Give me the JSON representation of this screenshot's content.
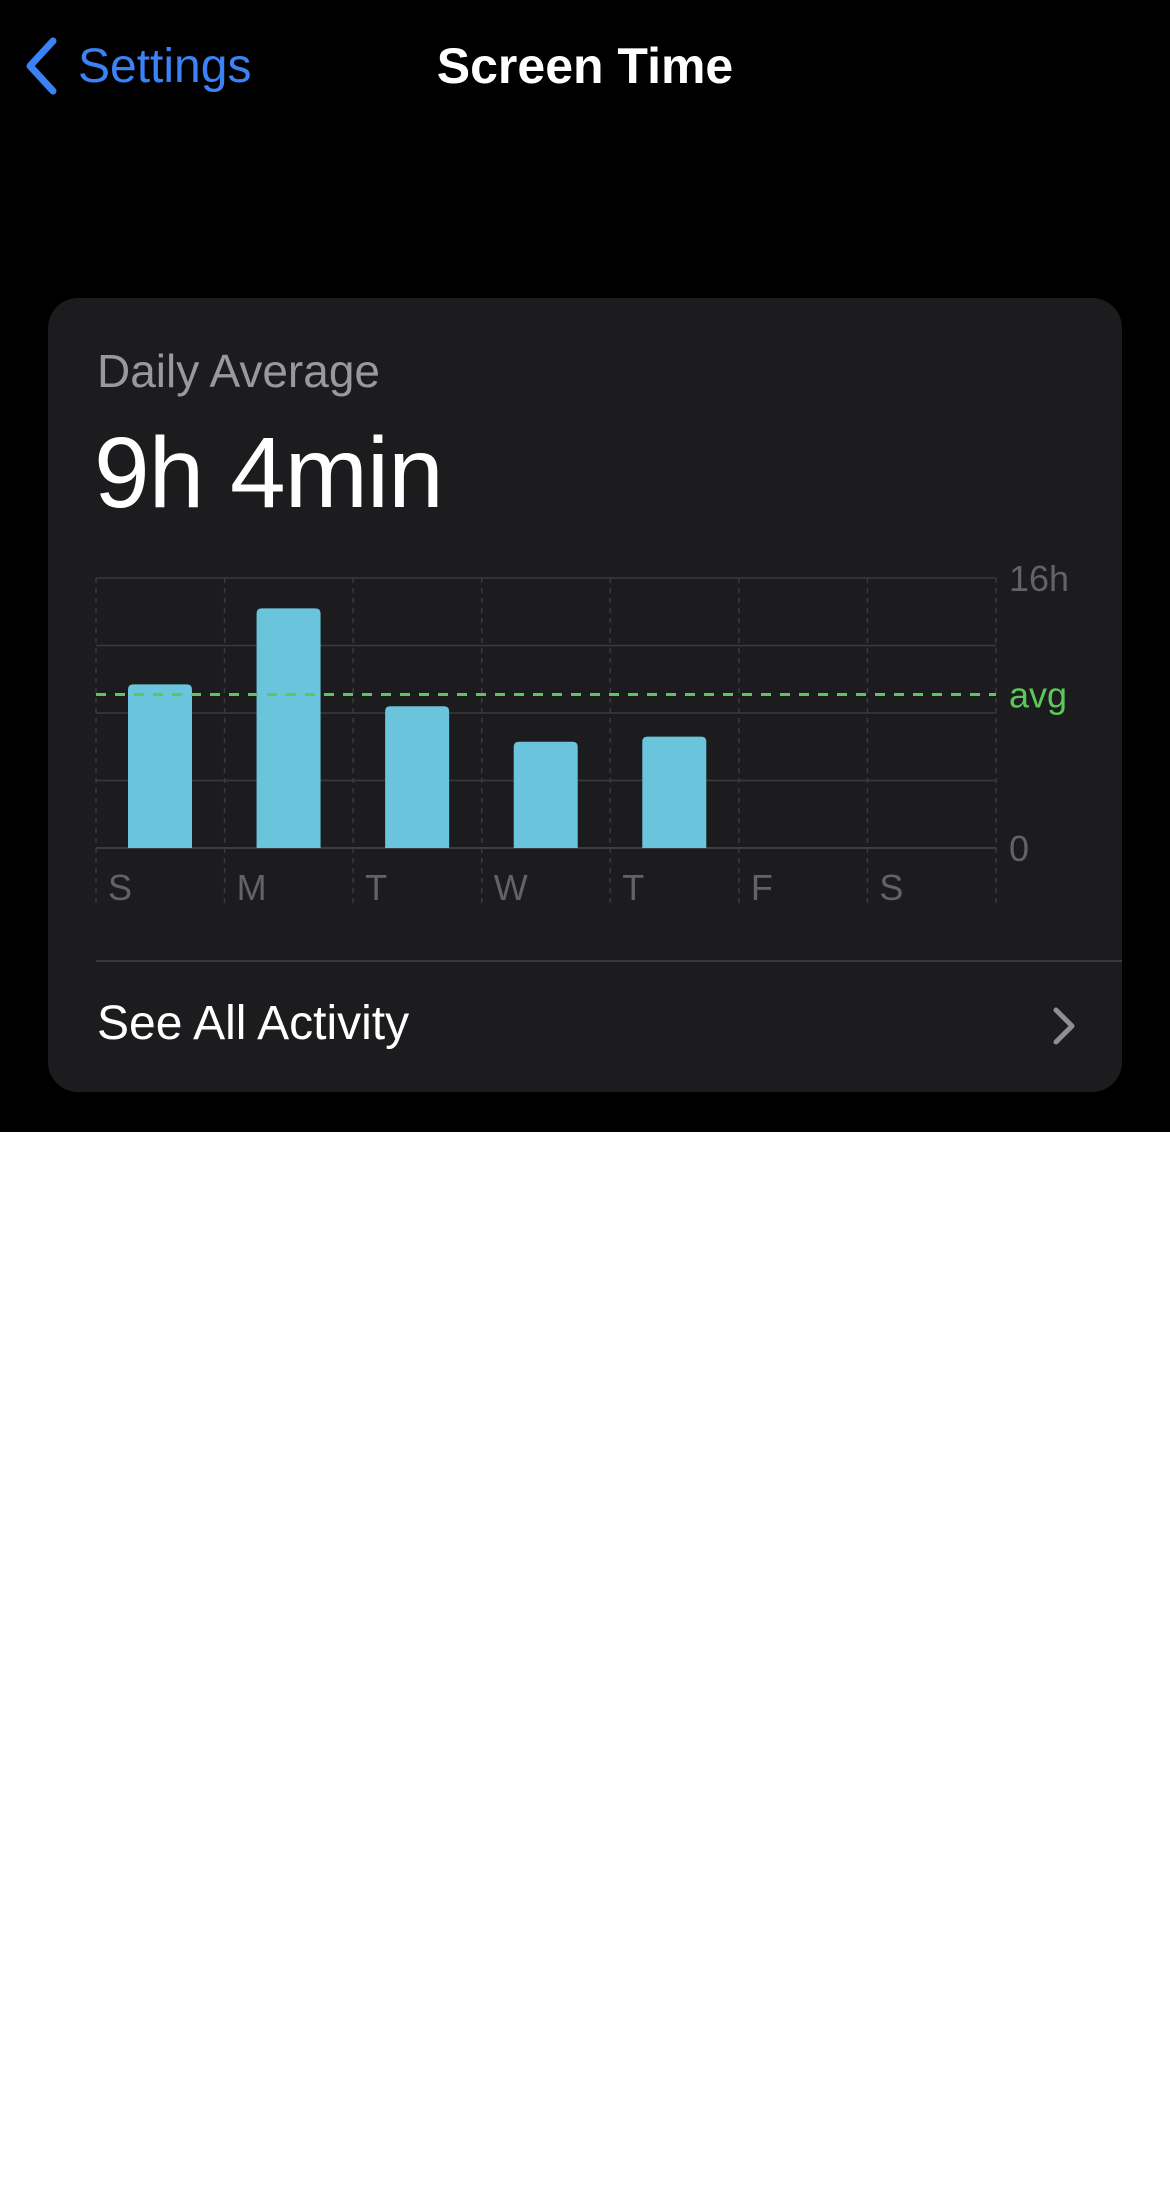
{
  "nav": {
    "back_label": "Settings",
    "title": "Screen Time"
  },
  "card": {
    "daily_label": "Daily Average",
    "daily_value": "9h 4min",
    "see_all_label": "See All Activity"
  },
  "colors": {
    "accent": "#3b82f6",
    "bar": "#6ac4dc",
    "avg_line": "#5ac85a",
    "card_bg": "#1c1c1e"
  },
  "chart_data": {
    "type": "bar",
    "categories": [
      "S",
      "M",
      "T",
      "W",
      "T",
      "F",
      "S"
    ],
    "values": [
      9.7,
      14.2,
      8.4,
      6.3,
      6.6,
      null,
      null
    ],
    "ylim": [
      0,
      16
    ],
    "y_tick_labels": [
      "16h",
      "0"
    ],
    "average": 9.1,
    "average_label": "avg",
    "grid": true
  }
}
